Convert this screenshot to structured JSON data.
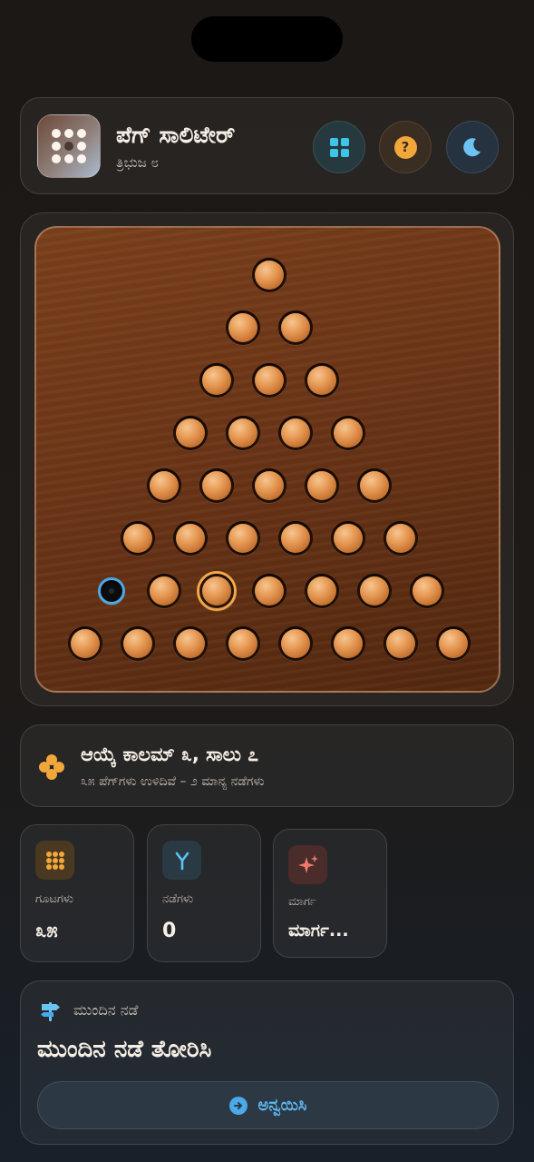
{
  "app": {
    "title": "ಪೆಗ್ ಸಾಲಿಟೇರ್",
    "subtitle": "ತ್ರಿಭುಜ ೮"
  },
  "header_buttons": [
    {
      "name": "variants",
      "icon": "grid-icon",
      "color": "#3ec6ea"
    },
    {
      "name": "help",
      "icon": "help-icon",
      "label": "?",
      "color": "#f2a73b"
    },
    {
      "name": "theme",
      "icon": "moon-icon",
      "color": "#6cc3f2"
    }
  ],
  "board": {
    "shape": "triangle",
    "rows": 8,
    "cells": [
      [
        "peg"
      ],
      [
        "peg",
        "peg"
      ],
      [
        "peg",
        "peg",
        "peg"
      ],
      [
        "peg",
        "peg",
        "peg",
        "peg"
      ],
      [
        "peg",
        "peg",
        "peg",
        "peg",
        "peg"
      ],
      [
        "peg",
        "peg",
        "peg",
        "peg",
        "peg",
        "peg"
      ],
      [
        "empty-target",
        "peg",
        "peg-selected",
        "peg",
        "peg",
        "peg",
        "peg"
      ],
      [
        "peg",
        "peg",
        "peg",
        "peg",
        "peg",
        "peg",
        "peg",
        "peg"
      ]
    ]
  },
  "status": {
    "title": "ಆಯ್ಕೆ ಕಾಲಮ್ ೩, ಸಾಲು ೭",
    "subtitle": "೩೫ ಪೆಗ್‌ಗಳು ಉಳಿದಿವೆ – ೨ ಮಾನ್ಯ ನಡೆಗಳು"
  },
  "stats": [
    {
      "label": "ಗೂಟಗಳು",
      "value": "೩೫",
      "icon": "honeycomb-icon"
    },
    {
      "label": "ನಡೆಗಳು",
      "value": "0",
      "icon": "branch-icon"
    },
    {
      "label": "ಮಾರ್ಗ",
      "value": "ಮಾರ್ಗ...",
      "icon": "sparkle-icon"
    }
  ],
  "next_move": {
    "label": "ಮುಂದಿನ ನಡೆ",
    "title": "ಮುಂದಿನ ನಡೆ ತೋರಿಸಿ",
    "button_label": "ಅನ್ವಯಿಸಿ"
  },
  "colors": {
    "accent_blue": "#4aa9e8",
    "accent_orange": "#f2a73b",
    "peg": "#e69a55",
    "board": "#6a3416"
  }
}
